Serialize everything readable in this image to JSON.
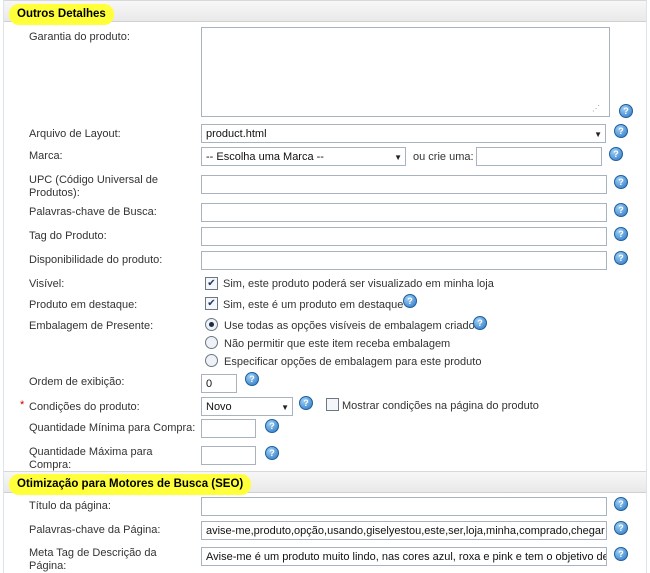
{
  "outros": {
    "title": "Outros Detalhes",
    "garantia_label": "Garantia do produto:",
    "garantia_value": "",
    "layout_label": "Arquivo de Layout:",
    "layout_value": "product.html",
    "marca_label": "Marca:",
    "marca_value": "-- Escolha uma Marca --",
    "marca_or_label": "ou crie uma:",
    "marca_new_value": "",
    "upc_label_1": "UPC (Código Universal de",
    "upc_label_2": "Produtos):",
    "upc_value": "",
    "palavras_label": "Palavras-chave de Busca:",
    "palavras_value": "",
    "tag_label": "Tag do Produto:",
    "tag_value": "",
    "disponibilidade_label": "Disponibilidade do produto:",
    "disponibilidade_value": "",
    "visivel_label": "Visível:",
    "visivel_text": "Sim, este produto poderá ser visualizado em minha loja",
    "destaque_label": "Produto em destaque:",
    "destaque_text": "Sim, este é um produto em destaque",
    "embalagem_label": "Embalagem de Presente:",
    "embalagem_opts": [
      "Use todas as opções visíveis de embalagem criados",
      "Não permitir que este item receba embalagem",
      "Especificar opções de embalagem para este produto"
    ],
    "ordem_label": "Ordem de exibição:",
    "ordem_value": "0",
    "condicoes_required": "*",
    "condicoes_label": "Condições do produto:",
    "condicoes_value": "Novo",
    "condicoes_show_text": "Mostrar condições na página do produto",
    "qtd_min_label": "Quantidade Mínima para Compra:",
    "qtd_min_value": "",
    "qtd_max_label_1": "Quantidade Máxima para",
    "qtd_max_label_2": "Compra:",
    "qtd_max_value": ""
  },
  "seo": {
    "title": "Otimização para Motores de Busca (SEO)",
    "titulo_label": "Título da página:",
    "titulo_value": "",
    "palavras_label": "Palavras-chave da Página:",
    "palavras_value": "avise-me,produto,opção,usando,giselyestou,este,ser,loja,minha,comprado,chegar",
    "meta_label_1": "Meta Tag de Descrição da",
    "meta_label_2": "Página:",
    "meta_value": "Avise-me é um produto muito lindo, nas cores azul, roxa e pink e tem o objetivo de"
  },
  "icons": {
    "help": "help-question-icon",
    "dropdown": "chevron-down-icon",
    "check": "checkmark-icon"
  },
  "colors": {
    "highlight": "#ffff3a",
    "help_icon": "#2a76c2",
    "required": "#cc0000"
  }
}
